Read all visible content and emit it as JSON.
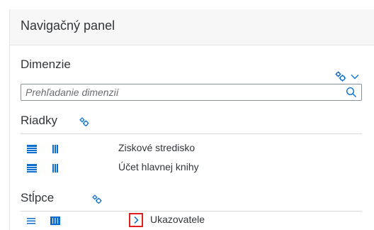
{
  "header": {
    "title": "Navigačný panel"
  },
  "dimensions": {
    "title": "Dimenzie",
    "settings_icon": "gear-icon",
    "dropdown_icon": "chevron-down-icon",
    "search": {
      "placeholder": "Prehľadanie dimenzií",
      "value": "",
      "icon": "search-icon"
    }
  },
  "rows": {
    "title": "Riadky",
    "settings_icon": "gear-icon",
    "items": [
      {
        "label": "Ziskové stredisko"
      },
      {
        "label": "Účet hlavnej knihy"
      }
    ]
  },
  "columns": {
    "title": "Stĺpce",
    "settings_icon": "gear-icon",
    "items": [
      {
        "label": "Ukazovatele",
        "expand_icon": "chevron-right-icon",
        "highlighted": true
      }
    ]
  },
  "colors": {
    "accent": "#0a6ed1",
    "highlight": "#e0201d",
    "text": "#32363a"
  }
}
